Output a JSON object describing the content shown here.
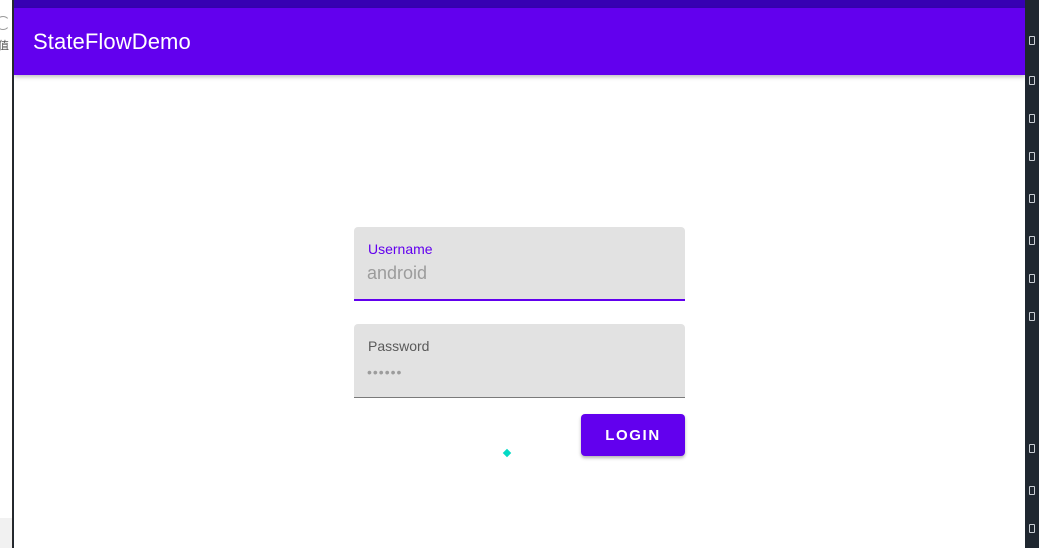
{
  "app": {
    "title": "StateFlowDemo"
  },
  "form": {
    "username": {
      "label": "Username",
      "value": "android"
    },
    "password": {
      "label": "Password",
      "value": "••••••"
    },
    "login_label": "LOGIN"
  },
  "colors": {
    "primary": "#6200ee",
    "primary_dark": "#3700b3",
    "accent": "#03dac5",
    "field_background": "#e2e2e2"
  }
}
